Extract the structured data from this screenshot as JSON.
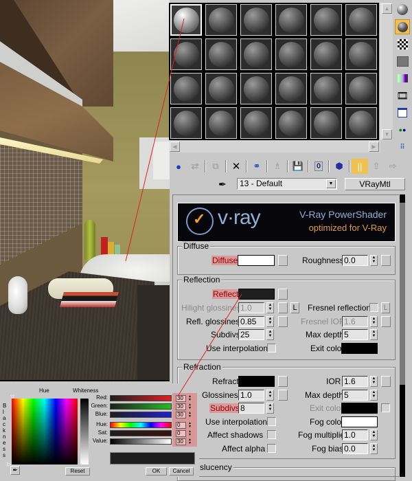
{
  "render_view": {
    "description": "bathroom interior render"
  },
  "material_editor": {
    "slots": {
      "rows": 4,
      "cols": 6,
      "active_index": 0
    },
    "right_toolbar": [
      {
        "name": "sample-type-icon"
      },
      {
        "name": "backlight-icon",
        "active": true
      },
      {
        "name": "background-checker-icon"
      },
      {
        "name": "sample-uv-tiling-icon"
      },
      {
        "name": "video-color-check-icon"
      },
      {
        "name": "make-preview-icon"
      },
      {
        "name": "options-icon"
      },
      {
        "name": "select-by-material-icon"
      },
      {
        "name": "material-navigator-icon"
      }
    ],
    "top_toolbar": [
      {
        "name": "get-material-icon"
      },
      {
        "name": "put-to-scene-icon"
      },
      {
        "name": "assign-to-selection-icon"
      },
      {
        "name": "reset-map-icon"
      },
      {
        "name": "make-unique-icon"
      },
      {
        "name": "put-to-library-icon"
      },
      {
        "name": "save-to-library-icon"
      },
      {
        "name": "material-effects-channel-icon"
      },
      {
        "name": "show-map-in-viewport-icon"
      },
      {
        "name": "show-end-result-icon",
        "active": true
      },
      {
        "name": "go-to-parent-icon"
      },
      {
        "name": "go-forward-to-sibling-icon"
      }
    ],
    "material_name": "13 - Default",
    "material_type": "VRayMtl",
    "banner": {
      "logo_text": "v·ray",
      "title": "V-Ray PowerShader",
      "subtitle": "optimized for V-Ray"
    },
    "diffuse": {
      "group": "Diffuse",
      "diffuse_label": "Diffuse",
      "diffuse_color": "#ffffff",
      "roughness_label": "Roughness",
      "roughness": "0.0"
    },
    "reflection": {
      "group": "Reflection",
      "reflect_label": "Reflect",
      "reflect_color": "#1e1e1e",
      "hilight_glossiness_label": "Hilight glossiness",
      "hilight_glossiness": "1.0",
      "lock_label": "L",
      "fresnel_label": "Fresnel reflections",
      "fresnel_lock_label": "L",
      "refl_glossiness_label": "Refl. glossiness",
      "refl_glossiness": "0.85",
      "fresnel_ior_label": "Fresnel IOR",
      "fresnel_ior": "1.6",
      "subdivs_label": "Subdivs",
      "subdivs": "25",
      "max_depth_label": "Max depth",
      "max_depth": "5",
      "use_interp_label": "Use interpolation",
      "exit_color_label": "Exit color",
      "exit_color": "#000000"
    },
    "refraction": {
      "group": "Refraction",
      "refract_label": "Refract",
      "refract_color": "#000000",
      "ior_label": "IOR",
      "ior": "1.6",
      "glossiness_label": "Glossiness",
      "glossiness": "1.0",
      "max_depth_label": "Max depth",
      "max_depth": "5",
      "subdivs_label": "Subdivs",
      "subdivs": "8",
      "exit_color_label": "Exit color",
      "exit_color": "#000000",
      "use_interp_label": "Use interpolation",
      "fog_color_label": "Fog color",
      "fog_color": "#ffffff",
      "affect_shadows_label": "Affect shadows",
      "fog_multiplier_label": "Fog multiplier",
      "fog_multiplier": "1.0",
      "affect_alpha_label": "Affect alpha",
      "fog_bias_label": "Fog bias",
      "fog_bias": "0.0"
    },
    "translucency": {
      "group_partial": "slucency"
    }
  },
  "color_picker": {
    "hue_label": "Hue",
    "whiteness_label": "Whiteness",
    "blackness_label": "B l a c k n e s s",
    "channels": [
      {
        "label": "Red:",
        "value": "30"
      },
      {
        "label": "Green:",
        "value": "30"
      },
      {
        "label": "Blue:",
        "value": "30"
      },
      {
        "label": "Hue:",
        "value": "0"
      },
      {
        "label": "Sat:",
        "value": "0"
      },
      {
        "label": "Value:",
        "value": "30"
      }
    ],
    "preview_color": "#1e1e1e",
    "reset_label": "Reset",
    "ok_label": "OK",
    "cancel_label": "Cancel"
  }
}
